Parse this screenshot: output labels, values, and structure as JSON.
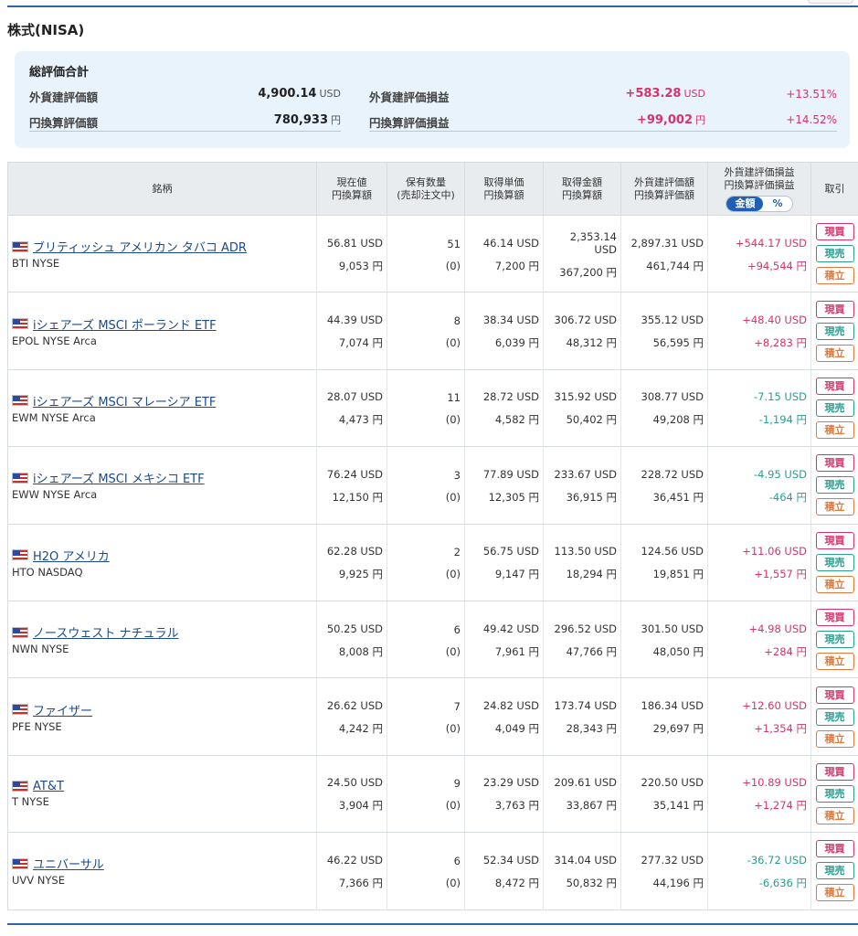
{
  "section_title": "株式(NISA)",
  "summary": {
    "title": "総評価合計",
    "foreign_value_label": "外貨建評価額",
    "foreign_value": "4,900.14",
    "foreign_value_unit": "USD",
    "yen_value_label": "円換算評価額",
    "yen_value": "780,933",
    "yen_value_unit": "円",
    "foreign_pl_label": "外貨建評価損益",
    "foreign_pl": "+583.28",
    "foreign_pl_unit": "USD",
    "foreign_pl_pct": "+13.51%",
    "yen_pl_label": "円換算評価損益",
    "yen_pl": "+99,002",
    "yen_pl_unit": "円",
    "yen_pl_pct": "+14.52%"
  },
  "table": {
    "headers": {
      "name": "銘柄",
      "price_1": "現在値",
      "price_2": "円換算額",
      "qty_1": "保有数量",
      "qty_2": "(売却注文中)",
      "unit_cost_1": "取得単価",
      "unit_cost_2": "円換算額",
      "cost_1": "取得金額",
      "cost_2": "円換算額",
      "value_1": "外貨建評価額",
      "value_2": "円換算評価額",
      "pl_1": "外貨建評価損益",
      "pl_2": "円換算評価損益",
      "toggle_amount": "金額",
      "toggle_pct": "%",
      "trade": "取引"
    },
    "buttons": {
      "buy": "現買",
      "sell": "現売",
      "accumulate": "積立"
    },
    "rows": [
      {
        "name": "ブリティッシュ アメリカン タバコ ADR",
        "ticker": "BTI NYSE",
        "price_usd": "56.81 USD",
        "price_jpy": "9,053 円",
        "qty": "51",
        "qty_pending": "(0)",
        "unit_cost_usd": "46.14 USD",
        "unit_cost_jpy": "7,200 円",
        "cost_usd": "2,353.14 USD",
        "cost_jpy": "367,200 円",
        "value_usd": "2,897.31 USD",
        "value_jpy": "461,744 円",
        "pl_usd": "+544.17 USD",
        "pl_jpy": "+94,544 円",
        "positive": true
      },
      {
        "name": "iシェアーズ MSCI ポーランド ETF",
        "ticker": "EPOL NYSE Arca",
        "price_usd": "44.39 USD",
        "price_jpy": "7,074 円",
        "qty": "8",
        "qty_pending": "(0)",
        "unit_cost_usd": "38.34 USD",
        "unit_cost_jpy": "6,039 円",
        "cost_usd": "306.72 USD",
        "cost_jpy": "48,312 円",
        "value_usd": "355.12 USD",
        "value_jpy": "56,595 円",
        "pl_usd": "+48.40 USD",
        "pl_jpy": "+8,283 円",
        "positive": true
      },
      {
        "name": "iシェアーズ MSCI マレーシア ETF",
        "ticker": "EWM NYSE Arca",
        "price_usd": "28.07 USD",
        "price_jpy": "4,473 円",
        "qty": "11",
        "qty_pending": "(0)",
        "unit_cost_usd": "28.72 USD",
        "unit_cost_jpy": "4,582 円",
        "cost_usd": "315.92 USD",
        "cost_jpy": "50,402 円",
        "value_usd": "308.77 USD",
        "value_jpy": "49,208 円",
        "pl_usd": "-7.15 USD",
        "pl_jpy": "-1,194 円",
        "positive": false
      },
      {
        "name": "iシェアーズ MSCI メキシコ ETF",
        "ticker": "EWW NYSE Arca",
        "price_usd": "76.24 USD",
        "price_jpy": "12,150 円",
        "qty": "3",
        "qty_pending": "(0)",
        "unit_cost_usd": "77.89 USD",
        "unit_cost_jpy": "12,305 円",
        "cost_usd": "233.67 USD",
        "cost_jpy": "36,915 円",
        "value_usd": "228.72 USD",
        "value_jpy": "36,451 円",
        "pl_usd": "-4.95 USD",
        "pl_jpy": "-464 円",
        "positive": false
      },
      {
        "name": "H2O アメリカ",
        "ticker": "HTO NASDAQ",
        "price_usd": "62.28 USD",
        "price_jpy": "9,925 円",
        "qty": "2",
        "qty_pending": "(0)",
        "unit_cost_usd": "56.75 USD",
        "unit_cost_jpy": "9,147 円",
        "cost_usd": "113.50 USD",
        "cost_jpy": "18,294 円",
        "value_usd": "124.56 USD",
        "value_jpy": "19,851 円",
        "pl_usd": "+11.06 USD",
        "pl_jpy": "+1,557 円",
        "positive": true
      },
      {
        "name": "ノースウェスト ナチュラル",
        "ticker": "NWN NYSE",
        "price_usd": "50.25 USD",
        "price_jpy": "8,008 円",
        "qty": "6",
        "qty_pending": "(0)",
        "unit_cost_usd": "49.42 USD",
        "unit_cost_jpy": "7,961 円",
        "cost_usd": "296.52 USD",
        "cost_jpy": "47,766 円",
        "value_usd": "301.50 USD",
        "value_jpy": "48,050 円",
        "pl_usd": "+4.98 USD",
        "pl_jpy": "+284 円",
        "positive": true
      },
      {
        "name": "ファイザー",
        "ticker": "PFE NYSE",
        "price_usd": "26.62 USD",
        "price_jpy": "4,242 円",
        "qty": "7",
        "qty_pending": "(0)",
        "unit_cost_usd": "24.82 USD",
        "unit_cost_jpy": "4,049 円",
        "cost_usd": "173.74 USD",
        "cost_jpy": "28,343 円",
        "value_usd": "186.34 USD",
        "value_jpy": "29,697 円",
        "pl_usd": "+12.60 USD",
        "pl_jpy": "+1,354 円",
        "positive": true
      },
      {
        "name": "AT&T",
        "ticker": "T NYSE",
        "price_usd": "24.50 USD",
        "price_jpy": "3,904 円",
        "qty": "9",
        "qty_pending": "(0)",
        "unit_cost_usd": "23.29 USD",
        "unit_cost_jpy": "3,763 円",
        "cost_usd": "209.61 USD",
        "cost_jpy": "33,867 円",
        "value_usd": "220.50 USD",
        "value_jpy": "35,141 円",
        "pl_usd": "+10.89 USD",
        "pl_jpy": "+1,274 円",
        "positive": true
      },
      {
        "name": "ユニバーサル",
        "ticker": "UVV NYSE",
        "price_usd": "46.22 USD",
        "price_jpy": "7,366 円",
        "qty": "6",
        "qty_pending": "(0)",
        "unit_cost_usd": "52.34 USD",
        "unit_cost_jpy": "8,472 円",
        "cost_usd": "314.04 USD",
        "cost_jpy": "50,832 円",
        "value_usd": "277.32 USD",
        "value_jpy": "44,196 円",
        "pl_usd": "-36.72 USD",
        "pl_jpy": "-6,636 円",
        "positive": false
      }
    ]
  },
  "colors": {
    "positive": "#d6336c",
    "negative": "#2a9d8f",
    "accent": "#1f5fb5",
    "header_bg": "#e9ecef",
    "summary_bg": "#e8f3fb"
  },
  "icons": {
    "flag": "us-flag-icon"
  }
}
